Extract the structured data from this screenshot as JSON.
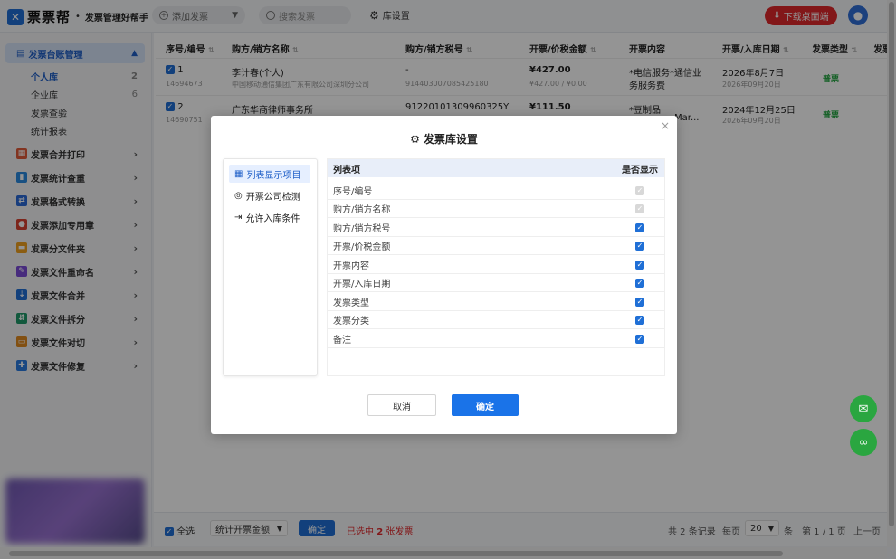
{
  "header": {
    "logo_mark": "✕",
    "logo_text": "票票帮",
    "logo_sub": "发票管理好帮手",
    "add_invoice": "添加发票",
    "search_placeholder": "搜索发票",
    "library_settings": "库设置",
    "download_desktop": "下载桌面端"
  },
  "sidebar": {
    "group": "发票台账管理",
    "sub_items": [
      {
        "label": "个人库",
        "count": "2"
      },
      {
        "label": "企业库",
        "count": "6"
      },
      {
        "label": "发票查验",
        "count": ""
      },
      {
        "label": "统计报表",
        "count": ""
      }
    ],
    "items": [
      {
        "label": "发票合并打印"
      },
      {
        "label": "发票统计查重"
      },
      {
        "label": "发票格式转换"
      },
      {
        "label": "发票添加专用章"
      },
      {
        "label": "发票分文件夹"
      },
      {
        "label": "发票文件重命名"
      },
      {
        "label": "发票文件合并"
      },
      {
        "label": "发票文件拆分"
      },
      {
        "label": "发票文件对切"
      },
      {
        "label": "发票文件修复"
      }
    ]
  },
  "table": {
    "columns": [
      "序号/编号",
      "购方/销方名称",
      "购方/销方税号",
      "开票/价税金额",
      "开票内容",
      "开票/入库日期",
      "发票类型",
      "发票"
    ],
    "rows": [
      {
        "index": "1",
        "code": "14694673",
        "name": "李计春(个人)",
        "name_sub": "中国移动通信集团广东有限公司深圳分公司",
        "tax_id": "-",
        "tax_id_sub": "914403007085425180",
        "amount": "¥427.00",
        "amount_sub": "¥427.00 / ¥0.00",
        "content": "*电信服务*通信业",
        "content_2": "务服务费",
        "date": "2026年8月7日",
        "date_sub": "2026年09月20日",
        "type": "普票"
      },
      {
        "index": "2",
        "code": "14690751",
        "name": "广东华商律师事务所",
        "name_sub": "",
        "tax_id": "91220101309960325Y",
        "tax_id_sub": "",
        "amount": "¥111.50",
        "amount_sub": "",
        "content": "*豆制品",
        "content_2": "Mar...",
        "date": "2024年12月25日",
        "date_sub": "2026年09月20日",
        "type": "普票"
      }
    ]
  },
  "footer": {
    "select_all": "全选",
    "stat_select": "统计开票金额",
    "confirm": "确定",
    "selected_prefix": "已选中",
    "selected_count": "2",
    "selected_suffix": "张发票",
    "total": "共 2 条记录",
    "per_page_label": "每页",
    "per_page": "20",
    "per_page_unit": "条",
    "page_info": "第 1 / 1 页",
    "prev": "上一页"
  },
  "modal": {
    "title": "发票库设置",
    "nav": [
      {
        "label": "列表显示项目",
        "icon": "grid-icon"
      },
      {
        "label": "开票公司检测",
        "icon": "search-icon"
      },
      {
        "label": "允许入库条件",
        "icon": "enter-icon"
      }
    ],
    "table_header": {
      "item": "列表项",
      "show": "是否显示"
    },
    "rows": [
      {
        "label": "序号/编号",
        "checked": true,
        "disabled": true
      },
      {
        "label": "购方/销方名称",
        "checked": true,
        "disabled": true
      },
      {
        "label": "购方/销方税号",
        "checked": true,
        "disabled": false
      },
      {
        "label": "开票/价税金额",
        "checked": true,
        "disabled": false
      },
      {
        "label": "开票内容",
        "checked": true,
        "disabled": false
      },
      {
        "label": "开票/入库日期",
        "checked": true,
        "disabled": false
      },
      {
        "label": "发票类型",
        "checked": true,
        "disabled": false
      },
      {
        "label": "发票分类",
        "checked": true,
        "disabled": false
      },
      {
        "label": "备注",
        "checked": true,
        "disabled": false
      }
    ],
    "cancel": "取消",
    "ok": "确定"
  },
  "colors": {
    "primary": "#1a73e8",
    "danger": "#e0292c",
    "success": "#2aa640"
  }
}
